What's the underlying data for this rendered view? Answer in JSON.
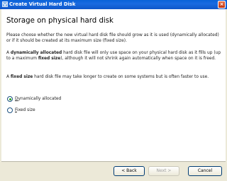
{
  "window": {
    "title": "Create Virtual Hard Disk",
    "close_glyph": "×"
  },
  "page": {
    "heading": "Storage on physical hard disk",
    "para1": "Please choose whether the new virtual hard disk file should grow as it is used (dynamically allocated) or if it should be created at its maximum size (fixed size).",
    "para2_a": "A ",
    "para2_b1": "dynamically allocated",
    "para2_c": " hard disk file will only use space on your physical hard disk as it fills up (up to a maximum ",
    "para2_b2": "fixed size",
    "para2_d": "), although it will not shrink again automatically when space on it is freed.",
    "para3_a": "A ",
    "para3_b": "fixed size",
    "para3_c": " hard disk file may take longer to create on some systems but is often faster to use."
  },
  "options": [
    {
      "accel": "D",
      "rest": "ynamically allocated",
      "selected": true
    },
    {
      "accel": "F",
      "rest": "ixed size",
      "selected": false
    }
  ],
  "buttons": {
    "back": "< Back",
    "next": "Next >",
    "cancel": "Cancel"
  },
  "colors": {
    "title_bar": "#0a62d8",
    "dialog_bg": "#ece9d8",
    "radio_dot": "#21a121"
  }
}
